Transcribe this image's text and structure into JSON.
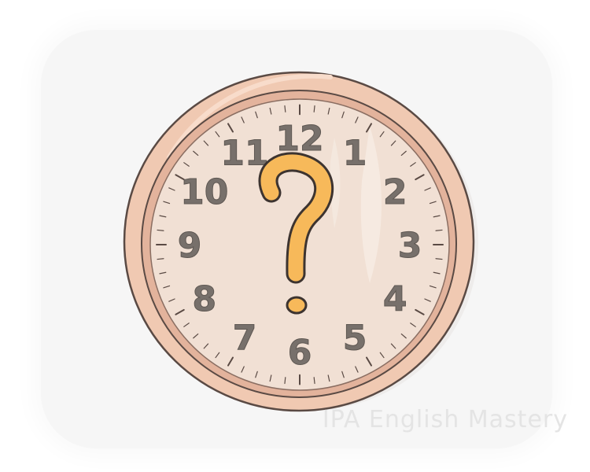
{
  "scene": {
    "watermark": "IPA English Mastery",
    "clock": {
      "numerals": [
        "12",
        "1",
        "2",
        "3",
        "4",
        "5",
        "6",
        "7",
        "8",
        "9",
        "10",
        "11"
      ],
      "center_symbol": "?"
    }
  },
  "colors": {
    "backdrop": "#f6f6f6",
    "outer_rim": "#f0c9b2",
    "rim_outline": "#5a4a44",
    "inner_rim": "#e3b39c",
    "dial": "#f1e0d4",
    "numerals": "#77706b",
    "question_mark": "#f7b95a",
    "question_outline": "#3d3430"
  }
}
